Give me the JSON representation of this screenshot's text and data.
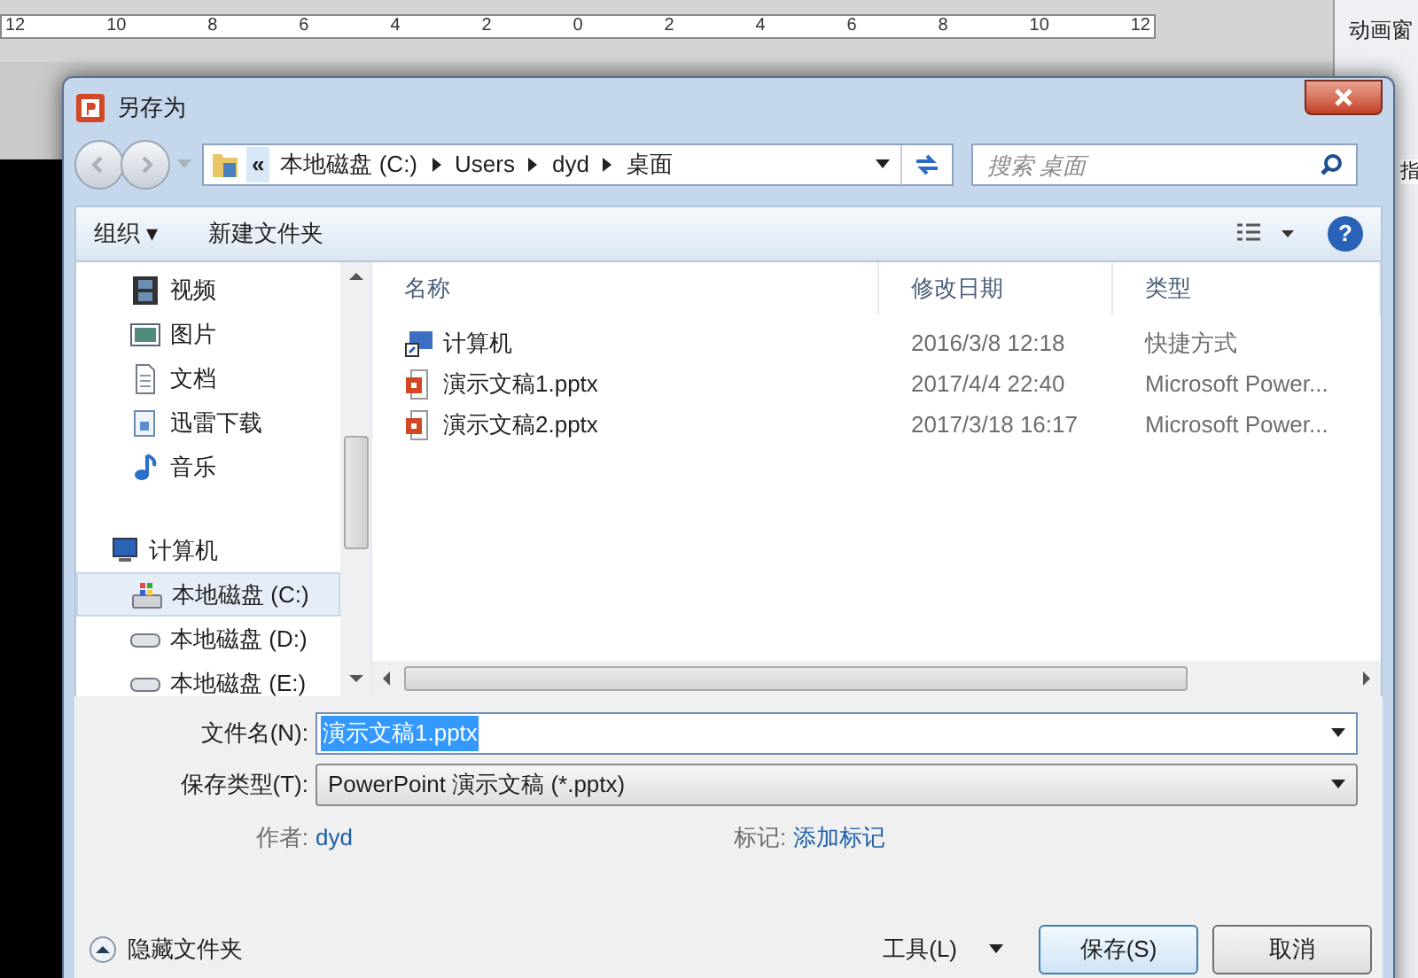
{
  "ruler": {
    "ticks": [
      "12",
      "10",
      "8",
      "6",
      "4",
      "2",
      "0",
      "2",
      "4",
      "6",
      "8",
      "10",
      "12"
    ]
  },
  "side_panel": {
    "title": "动画窗",
    "button": "指"
  },
  "window": {
    "title": "另存为"
  },
  "address_bar": {
    "overflow": "«",
    "crumbs": [
      "本地磁盘 (C:)",
      "Users",
      "dyd",
      "桌面"
    ]
  },
  "search": {
    "placeholder": "搜索 桌面"
  },
  "toolbar": {
    "organize": "组织 ▾",
    "new_folder": "新建文件夹",
    "help": "?"
  },
  "sidebar": {
    "items": [
      {
        "label": "视频",
        "kind": "video",
        "selected": false
      },
      {
        "label": "图片",
        "kind": "picture",
        "selected": false
      },
      {
        "label": "文档",
        "kind": "document",
        "selected": false
      },
      {
        "label": "迅雷下载",
        "kind": "download",
        "selected": false
      },
      {
        "label": "音乐",
        "kind": "music",
        "selected": false
      },
      {
        "label": "计算机",
        "kind": "computer",
        "selected": false,
        "children": [
          {
            "label": "本地磁盘 (C:)",
            "kind": "system_drive",
            "selected": true
          },
          {
            "label": "本地磁盘 (D:)",
            "kind": "drive",
            "selected": false
          },
          {
            "label": "本地磁盘 (E:)",
            "kind": "drive",
            "selected": false
          }
        ]
      }
    ]
  },
  "table": {
    "columns": [
      "名称",
      "修改日期",
      "类型"
    ],
    "rows": [
      {
        "kind": "shortcut",
        "name": "计算机",
        "date": "2016/3/8 12:18",
        "type": "快捷方式"
      },
      {
        "kind": "pptx",
        "name": "演示文稿1.pptx",
        "date": "2017/4/4 22:40",
        "type": "Microsoft Power..."
      },
      {
        "kind": "pptx",
        "name": "演示文稿2.pptx",
        "date": "2017/3/18 16:17",
        "type": "Microsoft Power..."
      }
    ]
  },
  "form": {
    "filename_label": "文件名(N):",
    "filename": "演示文稿1.pptx",
    "type_label": "保存类型(T):",
    "type": "PowerPoint 演示文稿 (*.pptx)",
    "author_label": "作者:",
    "author": "dyd",
    "tags_label": "标记:",
    "tags": "添加标记"
  },
  "footer": {
    "hide_folders": "隐藏文件夹",
    "tools": "工具(L)",
    "save": "保存(S)",
    "cancel": "取消"
  }
}
